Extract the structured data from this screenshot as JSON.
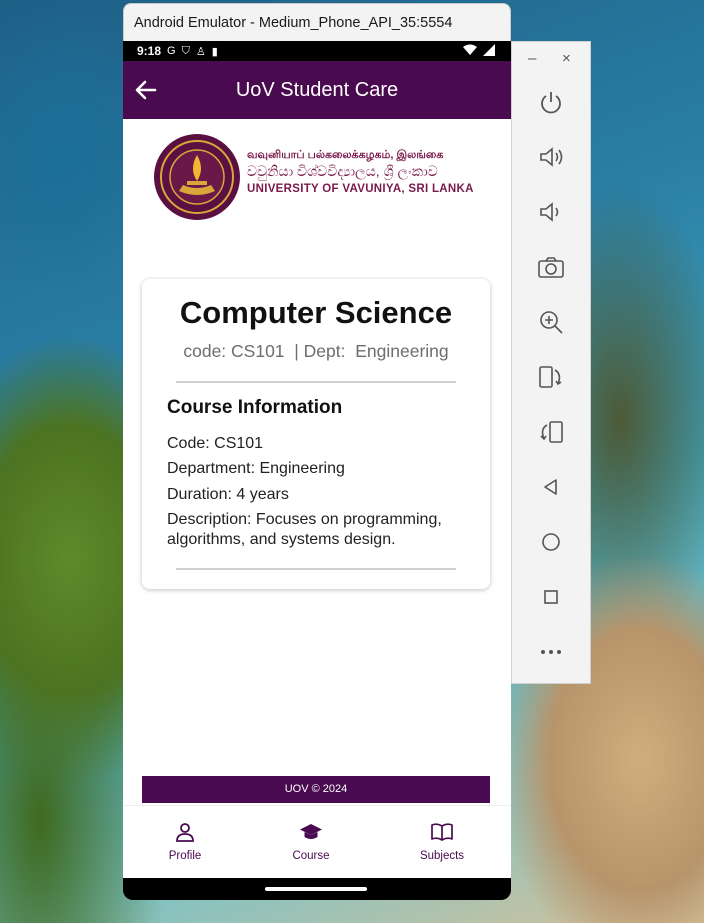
{
  "window": {
    "title": "Android Emulator - Medium_Phone_API_35:5554"
  },
  "statusbar": {
    "time": "9:18"
  },
  "app": {
    "title": "UoV Student Care"
  },
  "logo": {
    "line1": "வவுனியாப் பல்கலைக்கழகம், இலங்கை",
    "line2": "වවුනියා විශ්වවිද්‍යාලය, ශ්‍රී ලංකාව",
    "line3": "UNIVERSITY OF VAVUNIYA, SRI LANKA"
  },
  "course": {
    "name": "Computer Science",
    "meta": "code: CS101  | Dept:  Engineering",
    "section_title": "Course Information",
    "code_line": "Code: CS101",
    "department_line": "Department: Engineering",
    "duration_line": "Duration: 4 years",
    "description_line": "Description: Focuses on programming, algorithms, and systems design."
  },
  "footer": {
    "text": "UOV © 2024"
  },
  "nav": {
    "items": [
      {
        "label": "Profile",
        "icon": "person-icon"
      },
      {
        "label": "Course",
        "icon": "graduation-cap-icon"
      },
      {
        "label": "Subjects",
        "icon": "book-icon"
      }
    ]
  },
  "toolbar": {
    "minimize": "–",
    "close": "×",
    "buttons": [
      "power-icon",
      "volume-up-icon",
      "volume-down-icon",
      "camera-icon",
      "zoom-in-icon",
      "rotate-left-icon",
      "rotate-right-icon",
      "back-icon",
      "home-icon",
      "overview-icon",
      "more-icon"
    ]
  },
  "colors": {
    "primary": "#4a0a4f"
  }
}
